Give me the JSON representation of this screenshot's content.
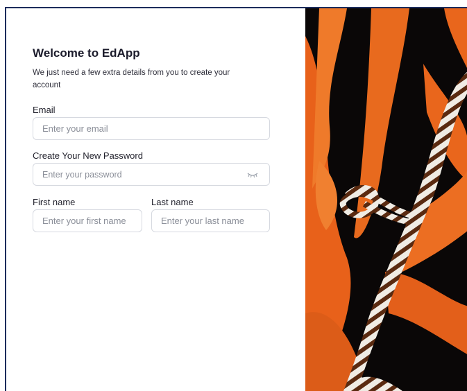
{
  "form": {
    "title": "Welcome to EdApp",
    "subtitle": "We just need a few extra details from you to create your account",
    "email": {
      "label": "Email",
      "placeholder": "Enter your email",
      "value": ""
    },
    "password": {
      "label": "Create Your New Password",
      "placeholder": "Enter your password",
      "value": "",
      "toggle_icon": "eye-closed-icon"
    },
    "first_name": {
      "label": "First name",
      "placeholder": "Enter your first name",
      "value": ""
    },
    "last_name": {
      "label": "Last name",
      "placeholder": "Enter your last name",
      "value": ""
    }
  },
  "colors": {
    "frame_border": "#1c2c5c",
    "coral": "#e8611a",
    "background_image": "#0a0707"
  }
}
